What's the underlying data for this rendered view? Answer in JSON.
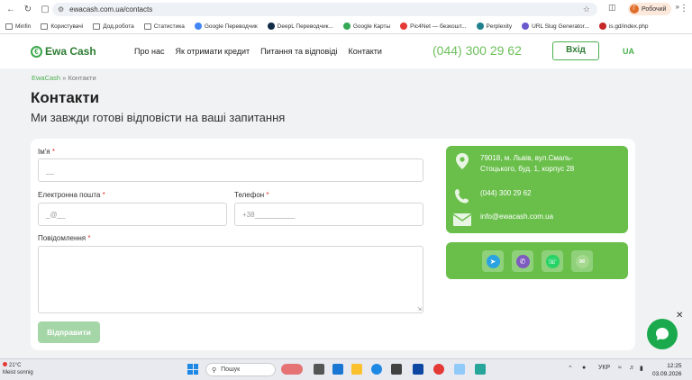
{
  "browser": {
    "url": "ewacash.com.ua/contacts",
    "profile_name": "Робочий",
    "profile_initial": "Г",
    "bookmarks": [
      {
        "label": "Minfin",
        "icon": "folder-icon",
        "color": "#777777"
      },
      {
        "label": "Користувачі",
        "icon": "folder-icon",
        "color": "#777777"
      },
      {
        "label": "Дод.робота",
        "icon": "folder-icon",
        "color": "#777777"
      },
      {
        "label": "Статистика",
        "icon": "folder-icon",
        "color": "#777777"
      },
      {
        "label": "Google Переводчик",
        "icon": "google-translate-icon",
        "color": "#4285f4"
      },
      {
        "label": "DeepL Переводчик...",
        "icon": "deepl-icon",
        "color": "#0f2b46"
      },
      {
        "label": "Google Карты",
        "icon": "google-maps-icon",
        "color": "#34a853"
      },
      {
        "label": "Pic4Net — безкошт...",
        "icon": "pic4net-icon",
        "color": "#e53935"
      },
      {
        "label": "Perplexity",
        "icon": "perplexity-icon",
        "color": "#20808d"
      },
      {
        "label": "URL Slug Generator...",
        "icon": "slug-icon",
        "color": "#6a5acd"
      },
      {
        "label": "is.gd/index.php",
        "icon": "isgd-icon",
        "color": "#c62828"
      }
    ]
  },
  "site": {
    "logo_text": "Ewa Cash",
    "nav": [
      "Про нас",
      "Як отримати кредит",
      "Питання та відповіді",
      "Контакти"
    ],
    "phone": "(044) 300 29 62",
    "login_label": "Вхід",
    "lang": "UA"
  },
  "breadcrumb": {
    "home": "EwaCash",
    "sep": "»",
    "current": "Контакти"
  },
  "page": {
    "title": "Контакти",
    "subtitle": "Ми завжди готові відповісти на ваші запитання"
  },
  "form": {
    "name_label": "Ім'я",
    "name_placeholder": "__",
    "email_label": "Електронна пошта",
    "email_placeholder": "_@__",
    "phone_label": "Телефон",
    "phone_placeholder": "+38__________",
    "message_label": "Повідомлення",
    "required_mark": "*",
    "submit_label": "Відправити"
  },
  "contacts": {
    "address": "79018, м. Львів, вул.Смаль-Стоцького, буд. 1, корпус 28",
    "phone": "(044) 300 29 62",
    "email": "info@ewacash.com.ua"
  },
  "socials": [
    {
      "name": "telegram-icon",
      "color": "#2aa3e0"
    },
    {
      "name": "viber-icon",
      "color": "#7d5bbf"
    },
    {
      "name": "whatsapp-icon",
      "color": "#25d366"
    },
    {
      "name": "email-social-icon",
      "color": "#6abf4b"
    }
  ],
  "taskbar": {
    "temperature": "21°C",
    "weather_text": "Meist sonnig",
    "search_label": "Пошук",
    "lang": "УКР",
    "time": "12:25",
    "date": "03.09.2026"
  },
  "colors": {
    "brand_green": "#6abf4b",
    "dark_green": "#2e7d32"
  }
}
